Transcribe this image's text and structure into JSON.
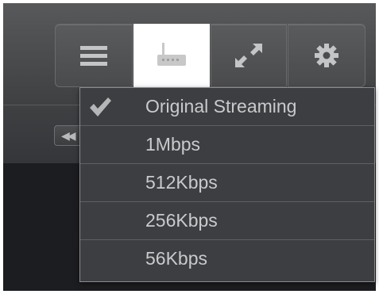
{
  "toolbar": {
    "buttons": [
      {
        "name": "menu",
        "icon": "hamburger-menu-icon"
      },
      {
        "name": "streaming-quality",
        "icon": "network-router-icon",
        "active": true
      },
      {
        "name": "fullscreen",
        "icon": "expand-arrows-icon"
      },
      {
        "name": "settings",
        "icon": "gear-icon"
      }
    ]
  },
  "player": {
    "rewind_icon": "rewind-icon",
    "rewind_glyph": "◀◀"
  },
  "quality_menu": {
    "selected_index": 0,
    "items": [
      {
        "label": "Original Streaming"
      },
      {
        "label": "1Mbps"
      },
      {
        "label": "512Kbps"
      },
      {
        "label": "256Kbps"
      },
      {
        "label": "56Kbps"
      }
    ]
  },
  "colors": {
    "accent_active_button": "#ffffff",
    "menu_text": "#c9cacc",
    "menu_background": "#3d3e41"
  }
}
